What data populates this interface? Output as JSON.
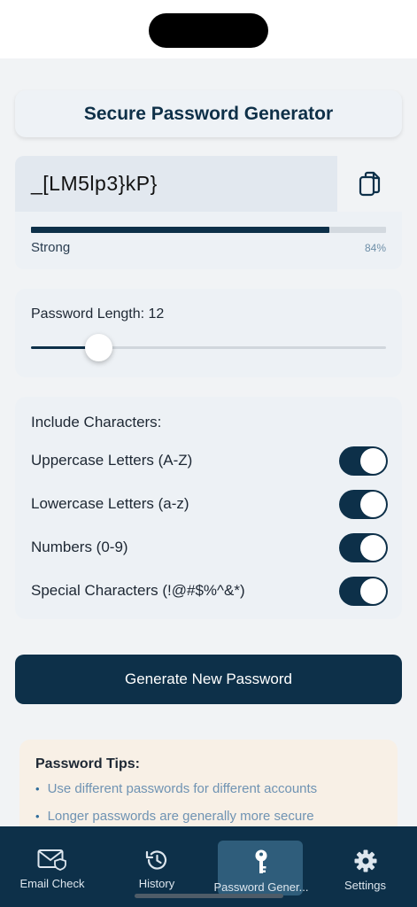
{
  "header": {
    "title": "Secure Password Generator"
  },
  "password": {
    "value": "_[LM5lp3}kP}",
    "strength_label": "Strong",
    "strength_percent_text": "84%",
    "strength_fraction": 0.84
  },
  "length": {
    "label": "Password Length: 12",
    "value": 12,
    "slider_fraction": 0.19
  },
  "characters": {
    "heading": "Include Characters:",
    "options": [
      {
        "label": "Uppercase Letters (A-Z)",
        "enabled": true
      },
      {
        "label": "Lowercase Letters (a-z)",
        "enabled": true
      },
      {
        "label": "Numbers (0-9)",
        "enabled": true
      },
      {
        "label": "Special Characters (!@#$%^&*)",
        "enabled": true
      }
    ]
  },
  "actions": {
    "generate_label": "Generate New Password"
  },
  "tips": {
    "heading": "Password Tips:",
    "items": [
      "Use different passwords for different accounts",
      "Longer passwords are generally more secure"
    ]
  },
  "tabs": [
    {
      "label": "Email Check",
      "icon": "email-shield-icon"
    },
    {
      "label": "History",
      "icon": "history-icon"
    },
    {
      "label": "Password Gener...",
      "icon": "key-icon",
      "active": true
    },
    {
      "label": "Settings",
      "icon": "gear-icon"
    }
  ],
  "colors": {
    "primary": "#0d3049",
    "accent_text": "#6f93b3",
    "tips_background": "#f8f0e6",
    "active_tab": "#2f5d7b"
  }
}
